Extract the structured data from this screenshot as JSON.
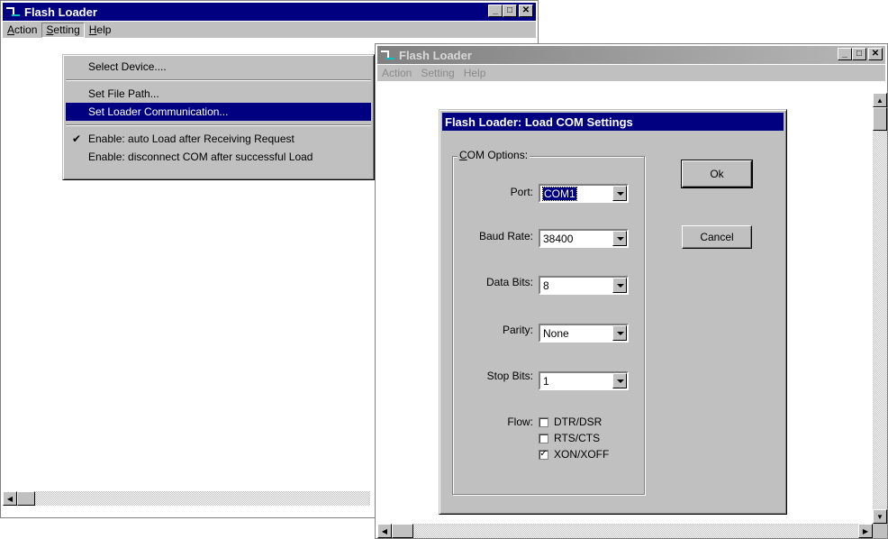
{
  "back_window": {
    "title": "Flash Loader",
    "menu": [
      {
        "label": "Action",
        "underline": "A"
      },
      {
        "label": "Setting",
        "underline": "S"
      },
      {
        "label": "Help",
        "underline": "H"
      }
    ],
    "setting_menu": {
      "items": [
        {
          "label": "Select Device....",
          "selected": false,
          "checked": false
        },
        {
          "label": "Set File Path...",
          "selected": false,
          "checked": false
        },
        {
          "label": "Set Loader Communication...",
          "selected": true,
          "checked": false
        },
        {
          "label": "Enable: auto Load after Receiving  Request",
          "selected": false,
          "checked": true
        },
        {
          "label": "Enable: disconnect COM after successful Load",
          "selected": false,
          "checked": false
        }
      ]
    }
  },
  "front_window": {
    "title": "Flash Loader",
    "menu": [
      {
        "label": "Action"
      },
      {
        "label": "Setting"
      },
      {
        "label": "Help"
      }
    ]
  },
  "dialog": {
    "title": "Flash Loader: Load  COM Settings",
    "group_label": "COM Options:",
    "fields": [
      {
        "label": "Port:",
        "value": "COM1"
      },
      {
        "label": "Baud Rate:",
        "value": "38400"
      },
      {
        "label": "Data Bits:",
        "value": "8"
      },
      {
        "label": "Parity:",
        "value": "None"
      },
      {
        "label": "Stop Bits:",
        "value": "1"
      }
    ],
    "flow_label": "Flow:",
    "flow_options": [
      {
        "label": "DTR/DSR",
        "checked": false
      },
      {
        "label": "RTS/CTS",
        "checked": false
      },
      {
        "label": "XON/XOFF",
        "checked": true
      }
    ],
    "ok_label": "Ok",
    "cancel_label": "Cancel"
  },
  "icons": {
    "minimize": "minimize-icon",
    "maximize": "maximize-icon",
    "close": "close-icon",
    "check": "checkmark-icon"
  }
}
